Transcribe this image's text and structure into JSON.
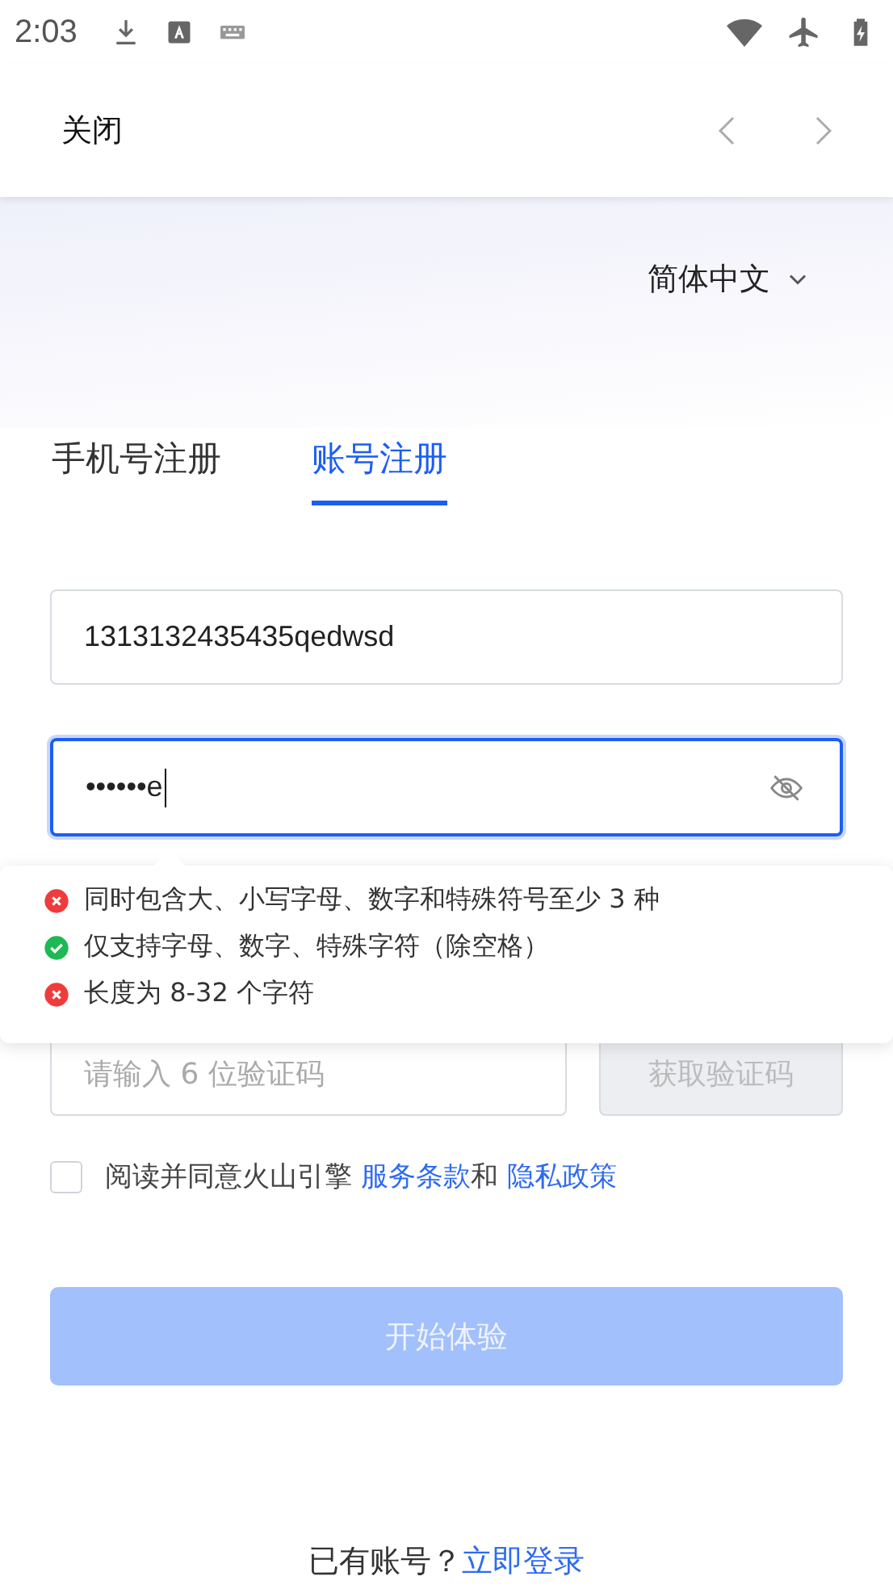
{
  "status_bar": {
    "time": "2:03"
  },
  "header": {
    "close": "关闭"
  },
  "language": {
    "label": "简体中文"
  },
  "tabs": [
    {
      "label": "手机号注册",
      "selected": false
    },
    {
      "label": "账号注册",
      "selected": true
    }
  ],
  "account_field": {
    "value": "1313132435435qedwsd"
  },
  "password_field": {
    "value": "••••••e",
    "focused": true,
    "revealed": false
  },
  "password_rules": [
    {
      "text": "同时包含大、小写字母、数字和特殊符号至少 3 种",
      "met": false
    },
    {
      "text": "仅支持字母、数字、特殊字符（除空格）",
      "met": true
    },
    {
      "text": "长度为 8-32 个字符",
      "met": false
    }
  ],
  "code_field": {
    "placeholder": "请输入 6 位验证码"
  },
  "get_code_button": {
    "label": "获取验证码"
  },
  "agreement": {
    "checked": false,
    "text": "阅读并同意火山引擎 ",
    "terms": "服务条款",
    "and": "和 ",
    "privacy": "隐私政策"
  },
  "submit_button": {
    "label": "开始体验",
    "disabled": true
  },
  "footer": {
    "text": "已有账号？",
    "link": "立即登录"
  }
}
